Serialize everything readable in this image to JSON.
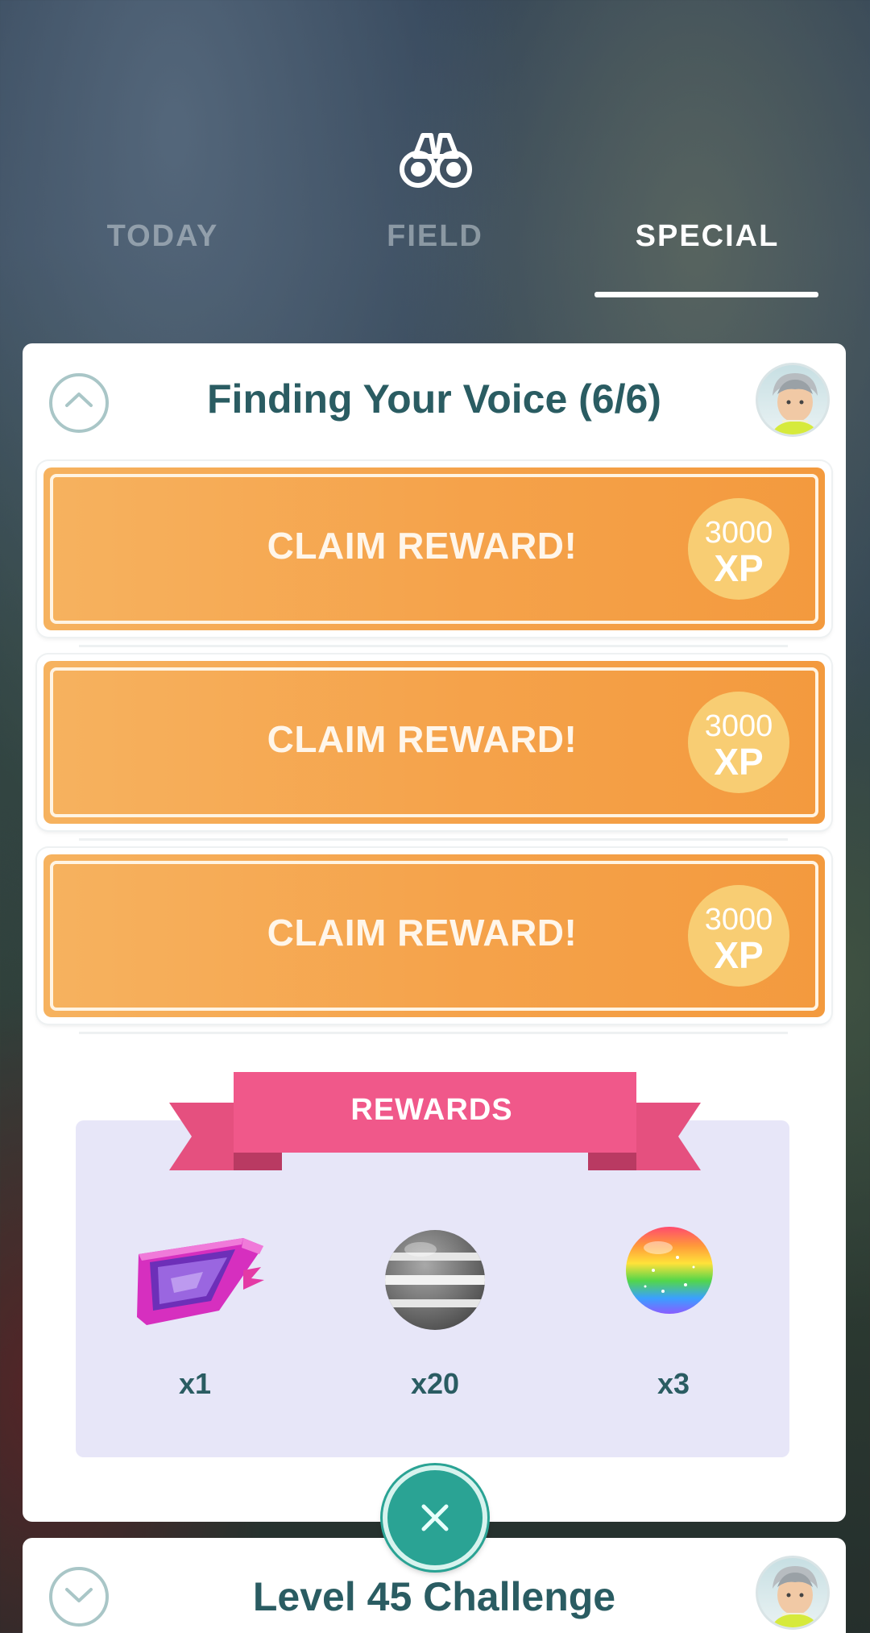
{
  "header": {
    "icon": "binoculars-icon"
  },
  "tabs": [
    {
      "label": "TODAY",
      "active": false
    },
    {
      "label": "FIELD",
      "active": false
    },
    {
      "label": "SPECIAL",
      "active": true
    }
  ],
  "research_card": {
    "title": "Finding Your Voice (6/6)",
    "claims": [
      {
        "label": "CLAIM REWARD!",
        "xp_amount": "3000",
        "xp_unit": "XP"
      },
      {
        "label": "CLAIM REWARD!",
        "xp_amount": "3000",
        "xp_unit": "XP"
      },
      {
        "label": "CLAIM REWARD!",
        "xp_amount": "3000",
        "xp_unit": "XP"
      }
    ],
    "rewards_title": "REWARDS",
    "rewards": [
      {
        "icon": "rocket-radar-icon",
        "count": "x1"
      },
      {
        "icon": "premium-ball-icon",
        "count": "x20"
      },
      {
        "icon": "rare-candy-icon",
        "count": "x3"
      }
    ]
  },
  "next_card": {
    "title": "Level 45 Challenge"
  },
  "colors": {
    "claim_orange": "#f5a24a",
    "xp_badge": "#f8cd73",
    "ribbon_pink": "#f0588a",
    "title_teal": "#2a5c62",
    "close_button": "#2aa394",
    "rewards_panel": "#e7e6f8"
  }
}
